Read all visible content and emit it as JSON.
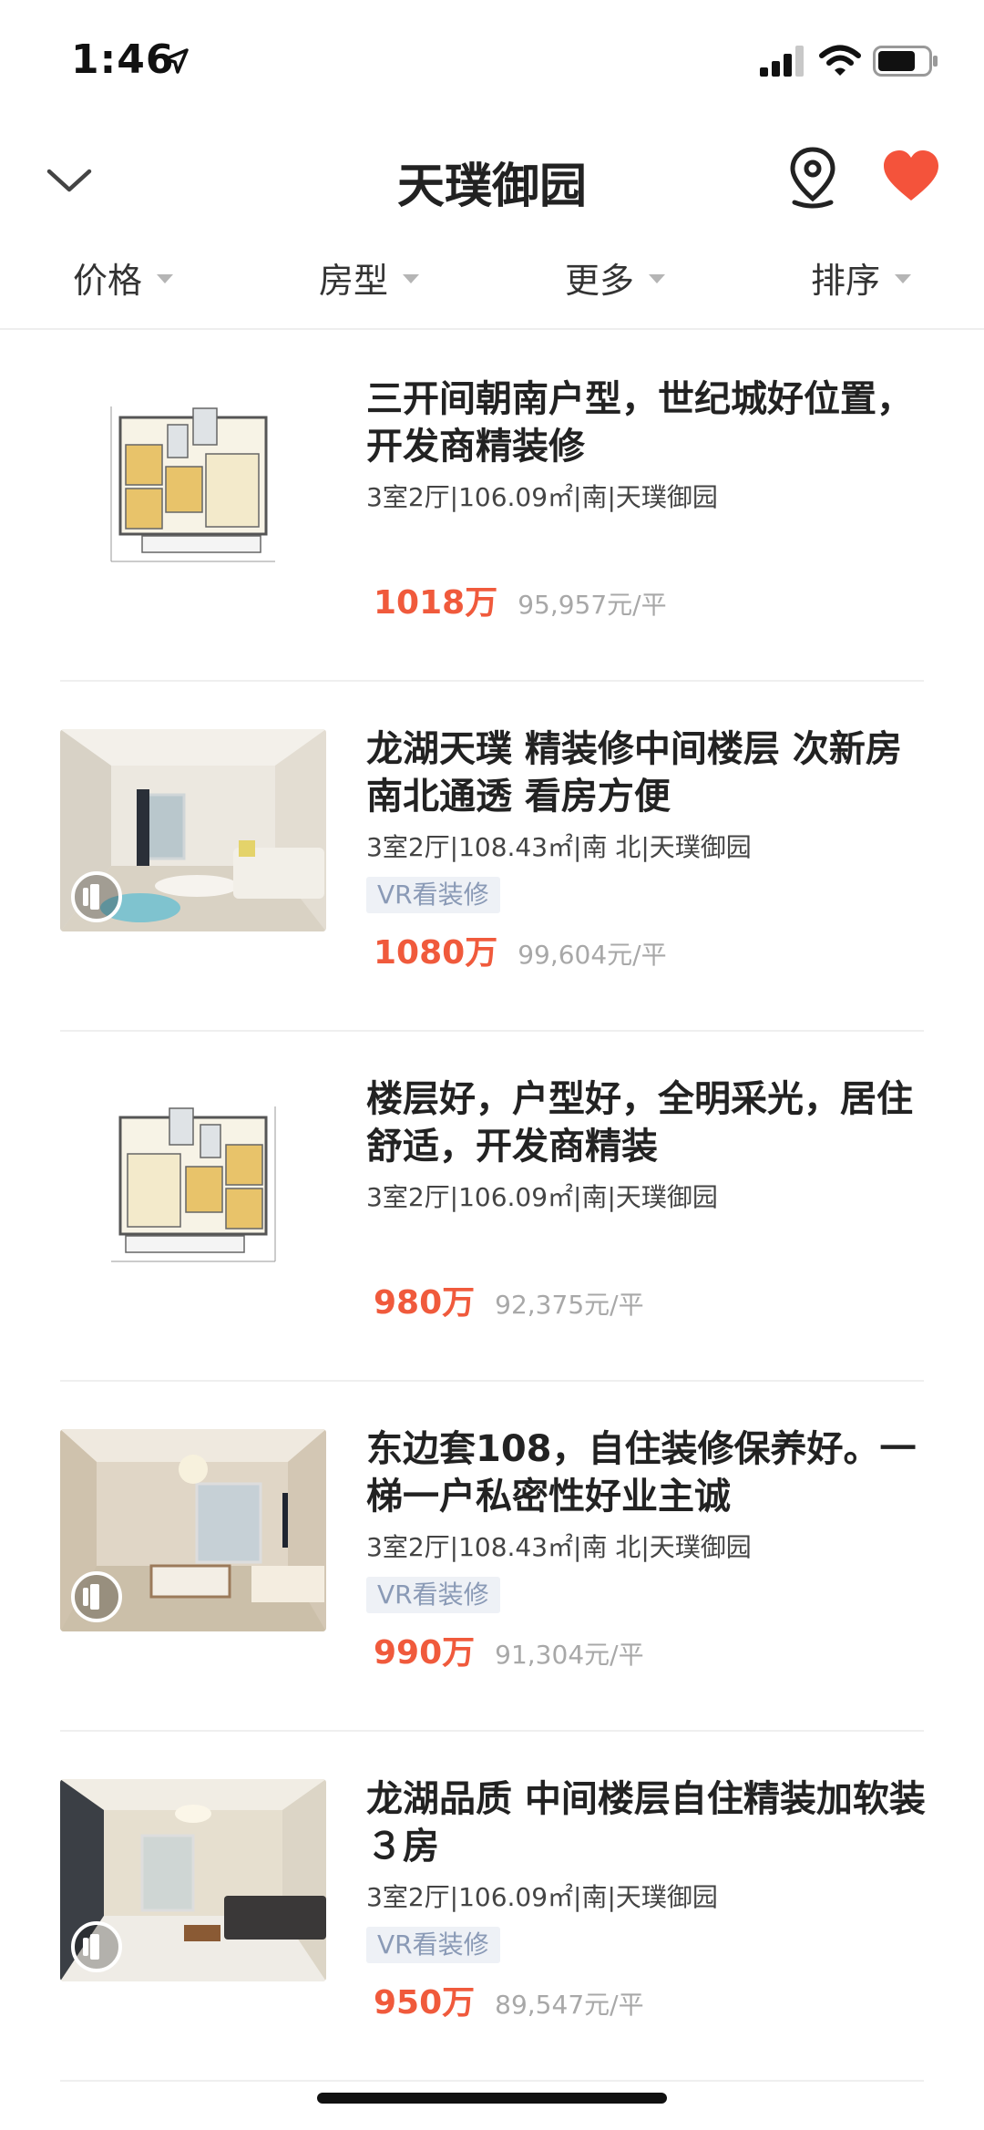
{
  "status_bar": {
    "time": "1:46"
  },
  "header": {
    "title": "天璞御园"
  },
  "filters": [
    {
      "label": "价格"
    },
    {
      "label": "房型"
    },
    {
      "label": "更多"
    },
    {
      "label": "排序"
    }
  ],
  "listings": [
    {
      "title": "三开间朝南户型，世纪城好位置，开发商精装修",
      "meta": "3室2厅|106.09㎡|南|天璞御园",
      "tag": "",
      "price": "1018万",
      "unit_price": "95,957元/平",
      "thumb": "floorplan"
    },
    {
      "title": "龙湖天璞  精装修中间楼层 次新房 南北通透 看房方便",
      "meta": "3室2厅|108.43㎡|南 北|天璞御园",
      "tag": "VR看装修",
      "price": "1080万",
      "unit_price": "99,604元/平",
      "thumb": "photo"
    },
    {
      "title": "楼层好，户型好，全明采光，居住舒适，开发商精装",
      "meta": "3室2厅|106.09㎡|南|天璞御园",
      "tag": "",
      "price": "980万",
      "unit_price": "92,375元/平",
      "thumb": "floorplan"
    },
    {
      "title": "东边套108，自住装修保养好。一梯一户私密性好业主诚",
      "meta": "3室2厅|108.43㎡|南 北|天璞御园",
      "tag": "VR看装修",
      "price": "990万",
      "unit_price": "91,304元/平",
      "thumb": "photo"
    },
    {
      "title": "龙湖品质  中间楼层自住精装加软装３房",
      "meta": "3室2厅|106.09㎡|南|天璞御园",
      "tag": "VR看装修",
      "price": "950万",
      "unit_price": "89,547元/平",
      "thumb": "photo"
    }
  ],
  "colors": {
    "accent": "#f05a3c",
    "heart": "#f4533b",
    "tag_text": "#8a9ab6",
    "tag_bg": "#eef1f6"
  }
}
